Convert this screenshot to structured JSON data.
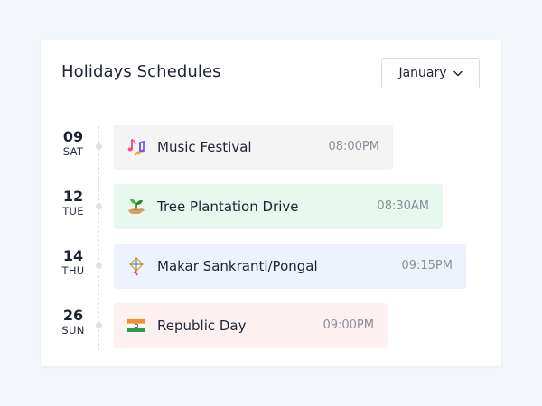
{
  "header": {
    "title": "Holidays Schedules",
    "month_select": {
      "value": "January",
      "icon": "chevron-down-icon"
    }
  },
  "events": [
    {
      "day": "09",
      "weekday": "SAT",
      "name": "Music Festival",
      "time": "08:00PM",
      "icon": "music-notes-icon",
      "color": "#f4f4f5"
    },
    {
      "day": "12",
      "weekday": "TUE",
      "name": "Tree Plantation Drive",
      "time": "08:30AM",
      "icon": "plant-hand-icon",
      "color": "#e9f8ee"
    },
    {
      "day": "14",
      "weekday": "THU",
      "name": "Makar Sankranti/Pongal",
      "time": "09:15PM",
      "icon": "kite-icon",
      "color": "#eef2fd"
    },
    {
      "day": "26",
      "weekday": "SUN",
      "name": "Republic Day",
      "time": "09:00PM",
      "icon": "india-flag-icon",
      "color": "#fdf0f0"
    }
  ]
}
